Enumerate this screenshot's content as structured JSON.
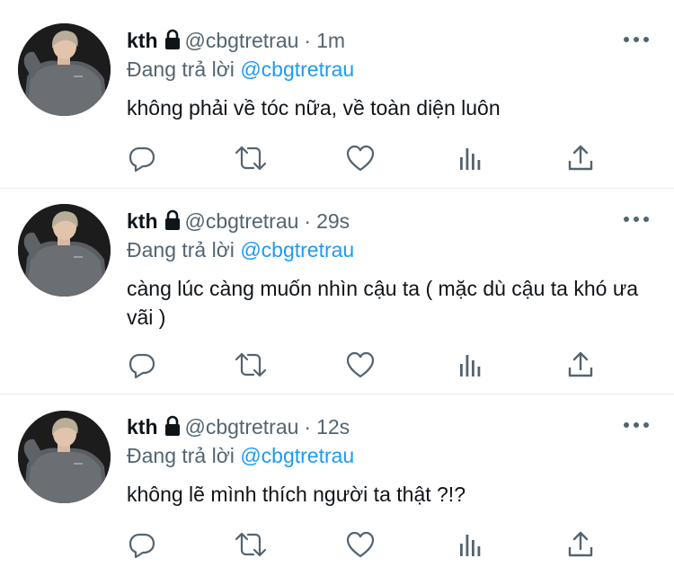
{
  "tweets": [
    {
      "name": "kth",
      "handle": "@cbgtretrau",
      "separator": "·",
      "time": "1m",
      "reply_prefix": "Đang trả lời",
      "reply_mention": "@cbgtretrau",
      "text": "không phải về tóc nữa, về toàn diện luôn"
    },
    {
      "name": "kth",
      "handle": "@cbgtretrau",
      "separator": "·",
      "time": "29s",
      "reply_prefix": "Đang trả lời",
      "reply_mention": "@cbgtretrau",
      "text": "càng lúc càng muốn nhìn cậu ta ( mặc dù cậu ta khó ưa vãi )"
    },
    {
      "name": "kth",
      "handle": "@cbgtretrau",
      "separator": "·",
      "time": "12s",
      "reply_prefix": "Đang trả lời",
      "reply_mention": "@cbgtretrau",
      "text": "không lẽ mình thích người ta thật ?!?"
    }
  ],
  "icons": {
    "lock": "lock-icon",
    "more": "more-icon",
    "reply": "reply-icon",
    "retweet": "retweet-icon",
    "like": "heart-icon",
    "views": "views-icon",
    "share": "share-icon"
  },
  "colors": {
    "text": "#0f1419",
    "secondary": "#536471",
    "mention": "#1d9bf0",
    "divider": "#e6ecf0"
  }
}
